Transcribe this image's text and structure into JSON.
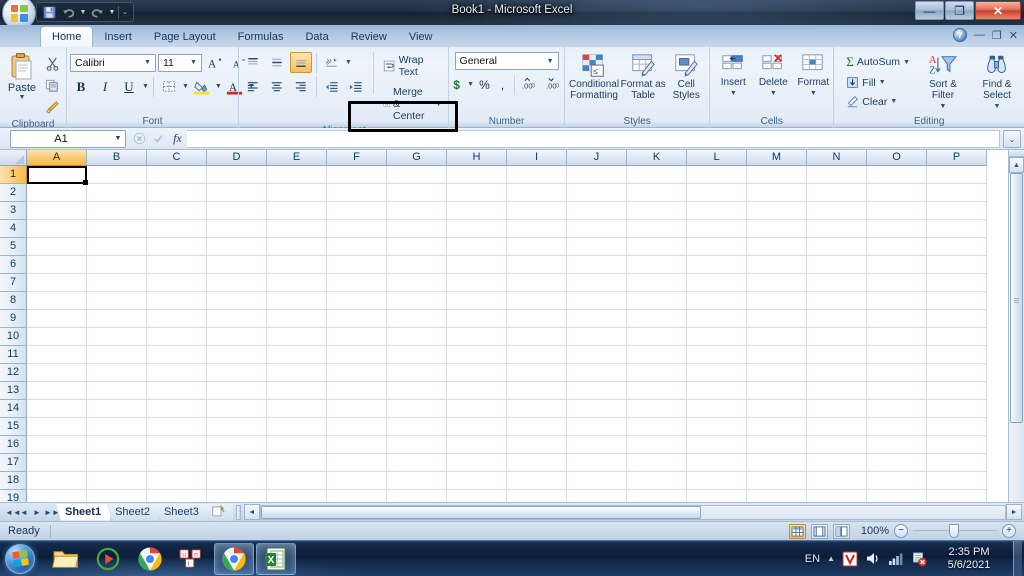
{
  "window": {
    "title": "Book1 - Microsoft Excel",
    "minimize": "—",
    "restore": "❐",
    "close": "✕"
  },
  "quick_access": {
    "save_icon": "save-icon",
    "undo_icon": "undo-icon",
    "redo_icon": "redo-icon",
    "customize_icon": "customize-qat-icon"
  },
  "document_controls": {
    "help": "?",
    "minimize": "—",
    "restore": "❐",
    "close": "✕"
  },
  "ribbon": {
    "tabs": [
      {
        "label": "Home",
        "active": true
      },
      {
        "label": "Insert",
        "active": false
      },
      {
        "label": "Page Layout",
        "active": false
      },
      {
        "label": "Formulas",
        "active": false
      },
      {
        "label": "Data",
        "active": false
      },
      {
        "label": "Review",
        "active": false
      },
      {
        "label": "View",
        "active": false
      }
    ],
    "groups": {
      "clipboard": {
        "label": "Clipboard",
        "paste": "Paste",
        "cut": "Cut",
        "copy": "Copy",
        "format_painter": "Format Painter"
      },
      "font": {
        "label": "Font",
        "font_name": "Calibri",
        "font_size": "11",
        "grow_font": "A",
        "shrink_font": "A",
        "bold": "B",
        "italic": "I",
        "underline": "U",
        "borders": "Borders",
        "fill_color": "Fill Color",
        "font_color": "A"
      },
      "alignment": {
        "label": "Alignment",
        "top_align": "Top Align",
        "middle_align": "Middle Align",
        "bottom_align": "Bottom Align",
        "orientation": "Orientation",
        "align_left": "Align Text Left",
        "center": "Center",
        "align_right": "Align Text Right",
        "decrease_indent": "Decrease Indent",
        "increase_indent": "Increase Indent",
        "wrap_text": "Wrap Text",
        "merge_center": "Merge & Center",
        "highlighted": "Merge & Center"
      },
      "number": {
        "label": "Number",
        "format": "General",
        "currency": "$",
        "percent": "%",
        "comma": ",",
        "increase_decimal": "Increase Decimal",
        "decrease_decimal": "Decrease Decimal"
      },
      "styles": {
        "label": "Styles",
        "conditional_formatting": "Conditional Formatting",
        "format_as_table": "Format as Table",
        "cell_styles": "Cell Styles"
      },
      "cells": {
        "label": "Cells",
        "insert": "Insert",
        "delete": "Delete",
        "format": "Format"
      },
      "editing": {
        "label": "Editing",
        "autosum": "AutoSum",
        "fill": "Fill",
        "clear": "Clear",
        "sort_filter": "Sort & Filter",
        "find_select": "Find & Select"
      }
    }
  },
  "formula_bar": {
    "name_box": "A1",
    "formula": "",
    "cancel_icon": "cancel-icon",
    "enter_icon": "enter-icon",
    "insert_function": "fx",
    "expand_icon": "expand-formula-bar-icon"
  },
  "grid": {
    "columns": [
      "A",
      "B",
      "C",
      "D",
      "E",
      "F",
      "G",
      "H",
      "I",
      "J",
      "K",
      "L",
      "M",
      "N",
      "O",
      "P"
    ],
    "rows": [
      1,
      2,
      3,
      4,
      5,
      6,
      7,
      8,
      9,
      10,
      11,
      12,
      13,
      14,
      15,
      16,
      17,
      18,
      19
    ],
    "selected_cell": "A1",
    "selected_column": "A",
    "selected_row": 1,
    "cell_values": []
  },
  "sheet_tabs": {
    "nav_first": "◄◄",
    "nav_prev": "◄",
    "nav_next": "►",
    "nav_last": "►►",
    "tabs": [
      {
        "label": "Sheet1",
        "active": true
      },
      {
        "label": "Sheet2",
        "active": false
      },
      {
        "label": "Sheet3",
        "active": false
      }
    ],
    "insert_sheet": "insert-worksheet-icon"
  },
  "status_bar": {
    "status": "Ready",
    "view_normal": "normal-view-icon",
    "view_page_layout": "page-layout-view-icon",
    "view_page_break": "page-break-preview-icon",
    "zoom_label": "100%",
    "zoom_out": "−",
    "zoom_in": "+"
  },
  "taskbar": {
    "start": "start-orb",
    "pinned": [
      {
        "name": "windows-explorer-icon",
        "open": false
      },
      {
        "name": "media-player-icon",
        "open": false
      },
      {
        "name": "google-chrome-icon",
        "open": false
      },
      {
        "name": "keyboard-layout-icon",
        "open": false
      },
      {
        "name": "google-chrome-window",
        "open": true
      },
      {
        "name": "microsoft-excel-window",
        "open": true
      }
    ],
    "tray": {
      "language": "EN",
      "show_hidden": "▲",
      "antivirus": "V",
      "volume": "volume-icon",
      "network": "network-icon",
      "action_center": "action-center-icon",
      "time": "2:35 PM",
      "date": "5/6/2021"
    }
  },
  "colors": {
    "accent": "#1f63b0",
    "ribbon_bg": "#eef4fb",
    "selection": "#f7b94f",
    "highlight_box": "#000000"
  }
}
